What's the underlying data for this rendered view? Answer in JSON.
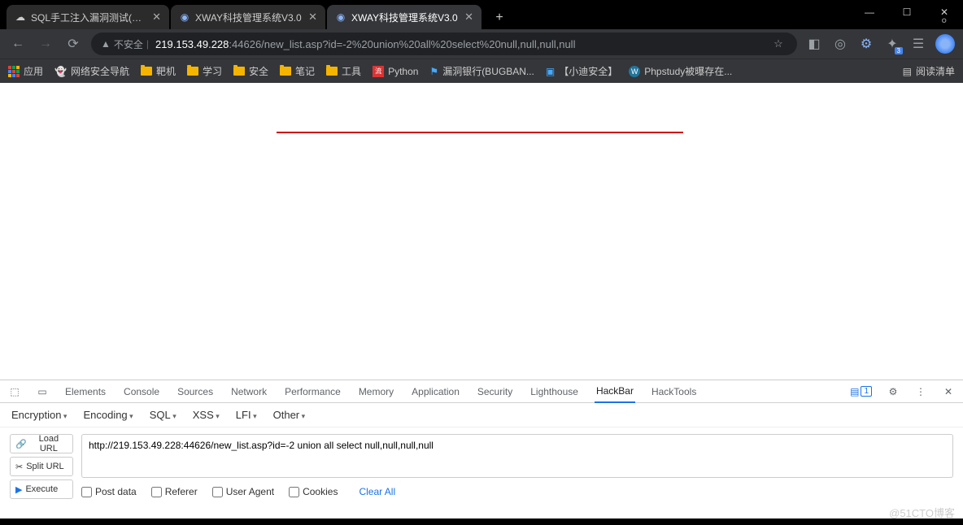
{
  "tabs": [
    {
      "title": "SQL手工注入漏洞测试(Sql Serve",
      "favicon": "cloud",
      "active": false
    },
    {
      "title": "XWAY科技管理系统V3.0",
      "favicon": "globe",
      "active": false
    },
    {
      "title": "XWAY科技管理系统V3.0",
      "favicon": "globe",
      "active": true
    }
  ],
  "address": {
    "insecure_label": "不安全",
    "host": "219.153.49.228",
    "port": ":44626",
    "path": "/new_list.asp?id=-2%20union%20all%20select%20null,null,null,null"
  },
  "ext_badge": "3",
  "bookmarks_label_apps": "应用",
  "bookmarks": [
    {
      "label": "网络安全导航",
      "icon": "ghost"
    },
    {
      "label": "靶机",
      "icon": "folder"
    },
    {
      "label": "学习",
      "icon": "folder"
    },
    {
      "label": "安全",
      "icon": "folder"
    },
    {
      "label": "笔记",
      "icon": "folder"
    },
    {
      "label": "工具",
      "icon": "folder"
    },
    {
      "label": "Python",
      "icon": "py"
    },
    {
      "label": "漏洞银行(BUGBAN...",
      "icon": "bug"
    },
    {
      "label": "【小迪安全】",
      "icon": "tv"
    },
    {
      "label": "Phpstudy被曝存在...",
      "icon": "wp"
    }
  ],
  "reading_list": "阅读清单",
  "devtools": {
    "tabs": [
      "Elements",
      "Console",
      "Sources",
      "Network",
      "Performance",
      "Memory",
      "Application",
      "Security",
      "Lighthouse",
      "HackBar",
      "HackTools"
    ],
    "active_tab": "HackBar",
    "comment_count": "1"
  },
  "hackbar": {
    "menu": [
      "Encryption",
      "Encoding",
      "SQL",
      "XSS",
      "LFI",
      "Other"
    ],
    "buttons": {
      "load": "Load URL",
      "split": "Split URL",
      "execute": "Execute"
    },
    "url_value": "http://219.153.49.228:44626/new_list.asp?id=-2 union all select null,null,null,null",
    "opts": {
      "post": "Post data",
      "referer": "Referer",
      "ua": "User Agent",
      "cookies": "Cookies"
    },
    "clear_all": "Clear All"
  },
  "watermark": "@51CTO博客"
}
